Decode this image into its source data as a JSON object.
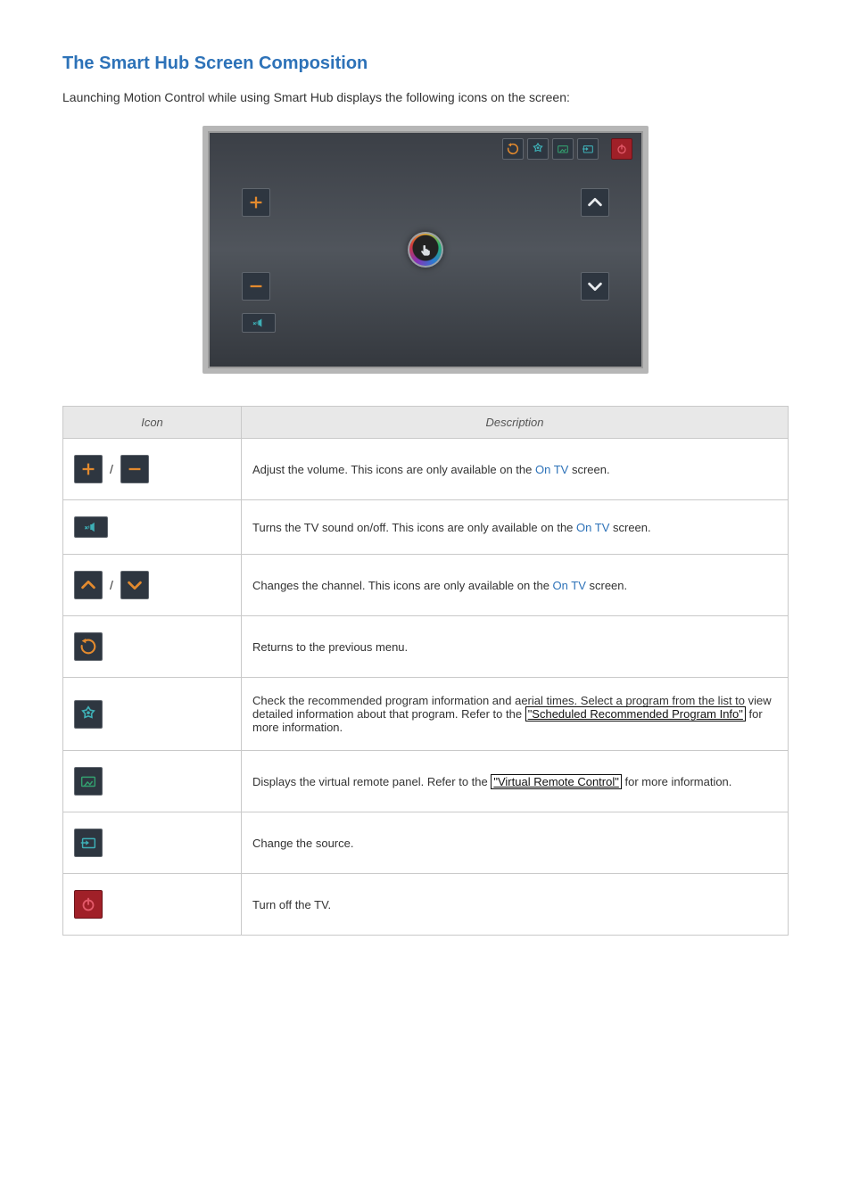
{
  "heading": "The Smart Hub Screen Composition",
  "intro": "Launching Motion Control while using Smart Hub displays the following icons on the screen:",
  "table": {
    "headers": {
      "icon": "Icon",
      "desc": "Description"
    },
    "rows": {
      "volume": {
        "pre": "Adjust the volume. This icons are only available on the ",
        "link": "On TV",
        "post": " screen."
      },
      "mute": {
        "pre": "Turns the TV sound on/off. This icons are only available on the ",
        "link": "On TV",
        "post": " screen."
      },
      "channel": {
        "pre": "Changes the channel. This icons are only available on the ",
        "link": "On TV",
        "post": " screen."
      },
      "return": {
        "text": "Returns to the previous menu."
      },
      "recommend": {
        "pre": "Check the recommended program information and aerial times. Select a program from the list to view detailed information about that program. Refer to the ",
        "boxed": "\"Scheduled Recommended Program Info\"",
        "post": " for more information."
      },
      "remote": {
        "pre": "Displays the virtual remote panel. Refer to the ",
        "boxed": "\"Virtual Remote Control\"",
        "post": " for more information."
      },
      "source": {
        "text": "Change the source."
      },
      "power": {
        "text": "Turn off the TV."
      }
    }
  },
  "icons": {
    "plus": "plus-icon",
    "minus": "minus-icon",
    "mute": "mute-icon",
    "ch_up": "chevron-up-icon",
    "ch_down": "chevron-down-icon",
    "return": "return-icon",
    "recommend": "recommend-icon",
    "remote": "remote-icon",
    "source": "source-icon",
    "power": "power-icon",
    "cursor": "hand-cursor-icon"
  }
}
